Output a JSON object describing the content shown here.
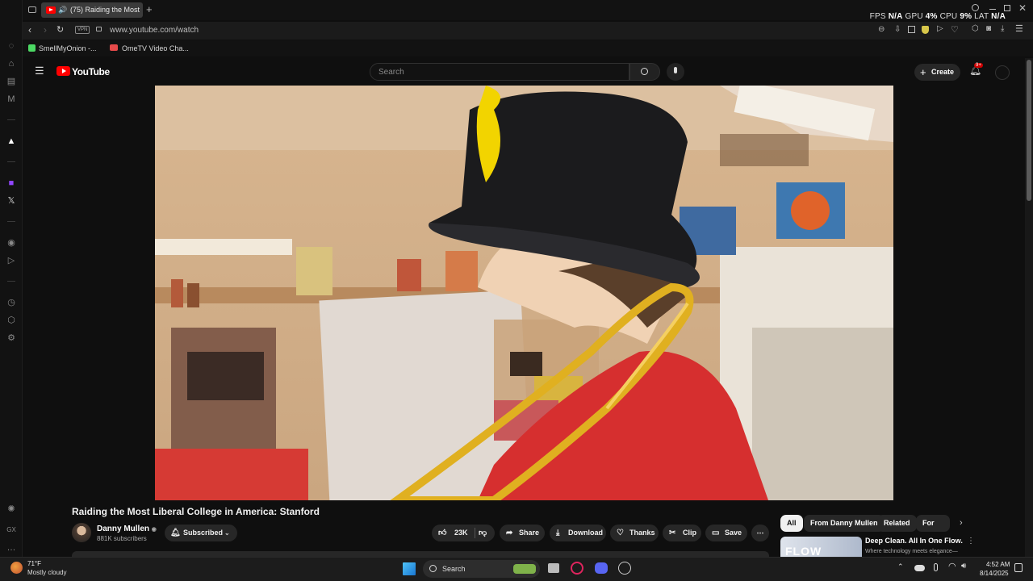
{
  "tab": {
    "title": "(75) Raiding the Most"
  },
  "stats": {
    "fps_label": "FPS",
    "fps": "N/A",
    "gpu_label": "GPU",
    "gpu": "4%",
    "cpu_label": "CPU",
    "cpu": "9%",
    "lat_label": "LAT",
    "lat": "N/A"
  },
  "address": {
    "vpn": "VPN",
    "url": "www.youtube.com/watch"
  },
  "bookmarks": [
    {
      "label": "SmellMyOnion -..."
    },
    {
      "label": "OmeTV Video Cha..."
    }
  ],
  "youtube": {
    "logo": "YouTube",
    "search_placeholder": "Search",
    "create": "Create",
    "notif_badge": "9+"
  },
  "video": {
    "title": "Raiding the Most Liberal College in America: Stanford"
  },
  "channel": {
    "name": "Danny Mullen",
    "subs": "881K subscribers",
    "subscribed": "Subscribed"
  },
  "actions": {
    "likes": "23K",
    "share": "Share",
    "download": "Download",
    "thanks": "Thanks",
    "clip": "Clip",
    "save": "Save"
  },
  "chips": [
    "All",
    "From Danny Mullen",
    "Related",
    "For you"
  ],
  "rec": {
    "title": "Deep Clean. All In One Flow.",
    "subtitle": "Where technology meets elegance—",
    "thumb_text": "FLOW"
  },
  "taskbar": {
    "temp": "71°F",
    "weather": "Mostly cloudy",
    "search": "Search",
    "time": "4:52 AM",
    "date": "8/14/2025"
  },
  "side": {
    "gx": "GX"
  },
  "colors": {
    "accent": "#ff0000",
    "bookmark_green": "#4cd964"
  }
}
